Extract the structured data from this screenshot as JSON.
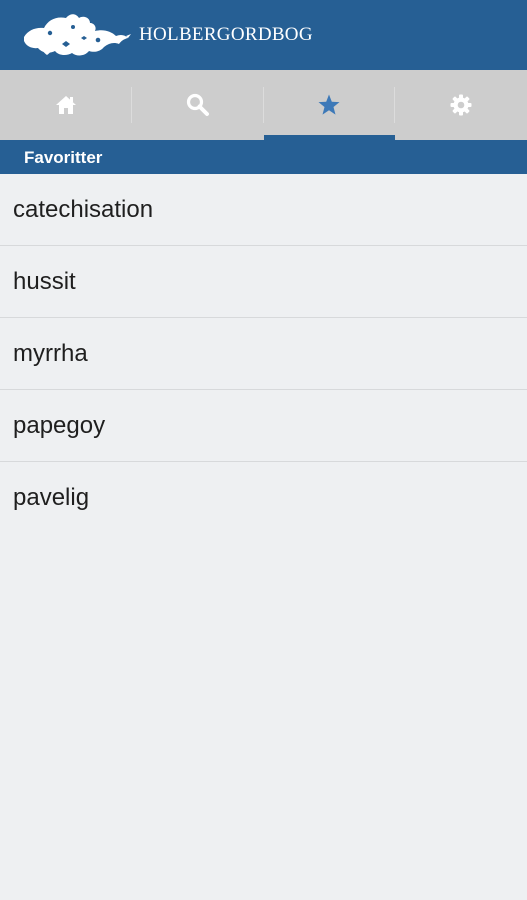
{
  "header": {
    "title": "HOLBERGORDBOG",
    "logo_icon": "lion-logo-icon",
    "background": "#265f94"
  },
  "tabs": [
    {
      "icon": "home-icon",
      "active": false
    },
    {
      "icon": "search-icon",
      "active": false
    },
    {
      "icon": "star-icon",
      "active": true
    },
    {
      "icon": "gear-icon",
      "active": false
    }
  ],
  "section": {
    "title": "Favoritter"
  },
  "favorites": [
    {
      "label": "catechisation"
    },
    {
      "label": "hussit"
    },
    {
      "label": "myrrha"
    },
    {
      "label": "papegoy"
    },
    {
      "label": "pavelig"
    }
  ],
  "colors": {
    "accent": "#265f94",
    "tab_bar": "#cdcdcd",
    "active_icon": "#3d79b8",
    "inactive_icon": "#ffffff",
    "list_background": "#eef0f2"
  }
}
